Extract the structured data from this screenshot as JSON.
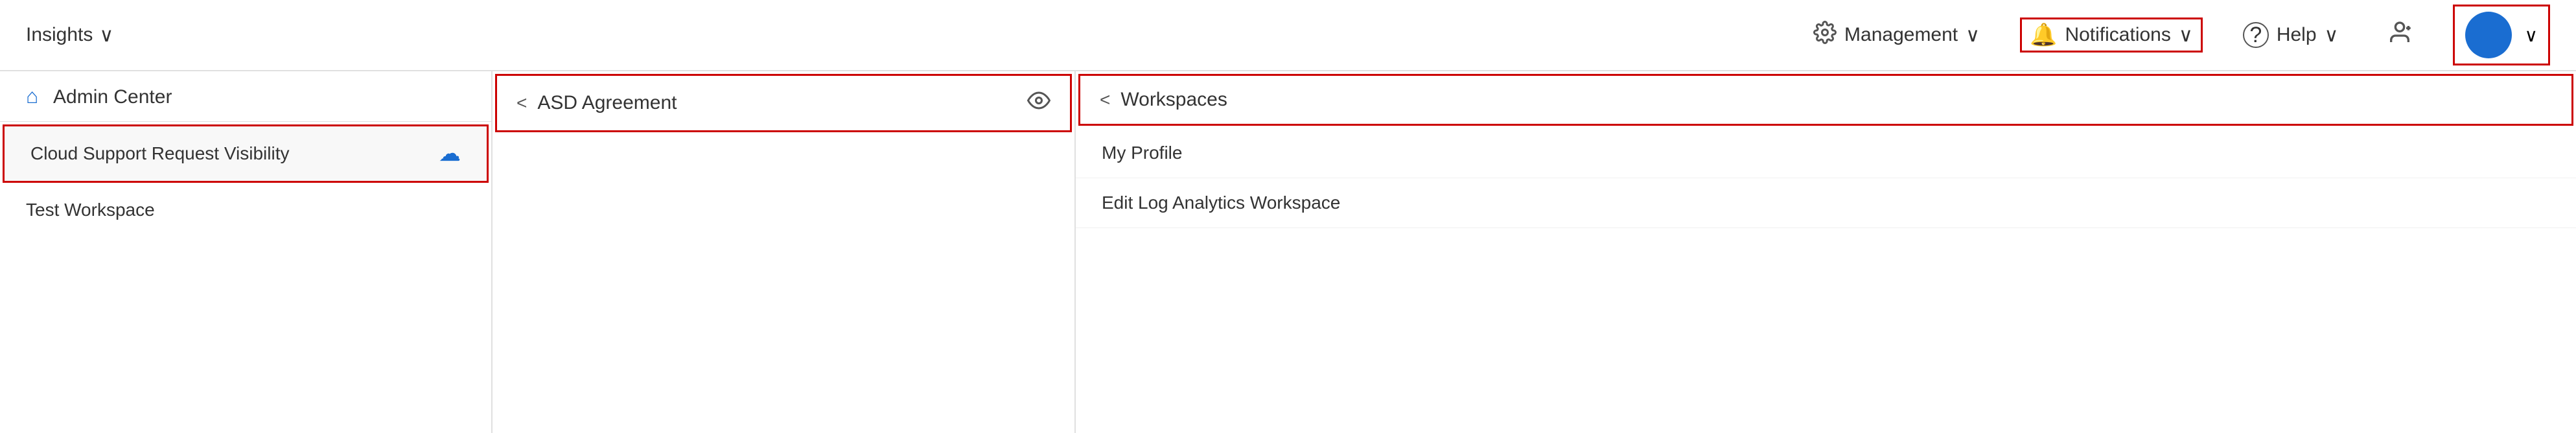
{
  "topbar": {
    "insights_label": "Insights",
    "management_label": "Management",
    "notifications_label": "Notifications",
    "help_label": "Help",
    "chevron": "∨"
  },
  "left_panel": {
    "header": "Admin Center",
    "items": [
      {
        "label": "Cloud Support Request Visibility",
        "has_icon": true,
        "highlighted": true
      },
      {
        "label": "Test Workspace",
        "has_icon": false,
        "highlighted": false
      }
    ]
  },
  "middle_panel": {
    "header": "ASD Agreement",
    "back_label": "<"
  },
  "right_panel": {
    "header": "Workspaces",
    "back_label": "<",
    "items": [
      {
        "label": "My Profile"
      },
      {
        "label": "Edit Log Analytics Workspace"
      }
    ]
  }
}
